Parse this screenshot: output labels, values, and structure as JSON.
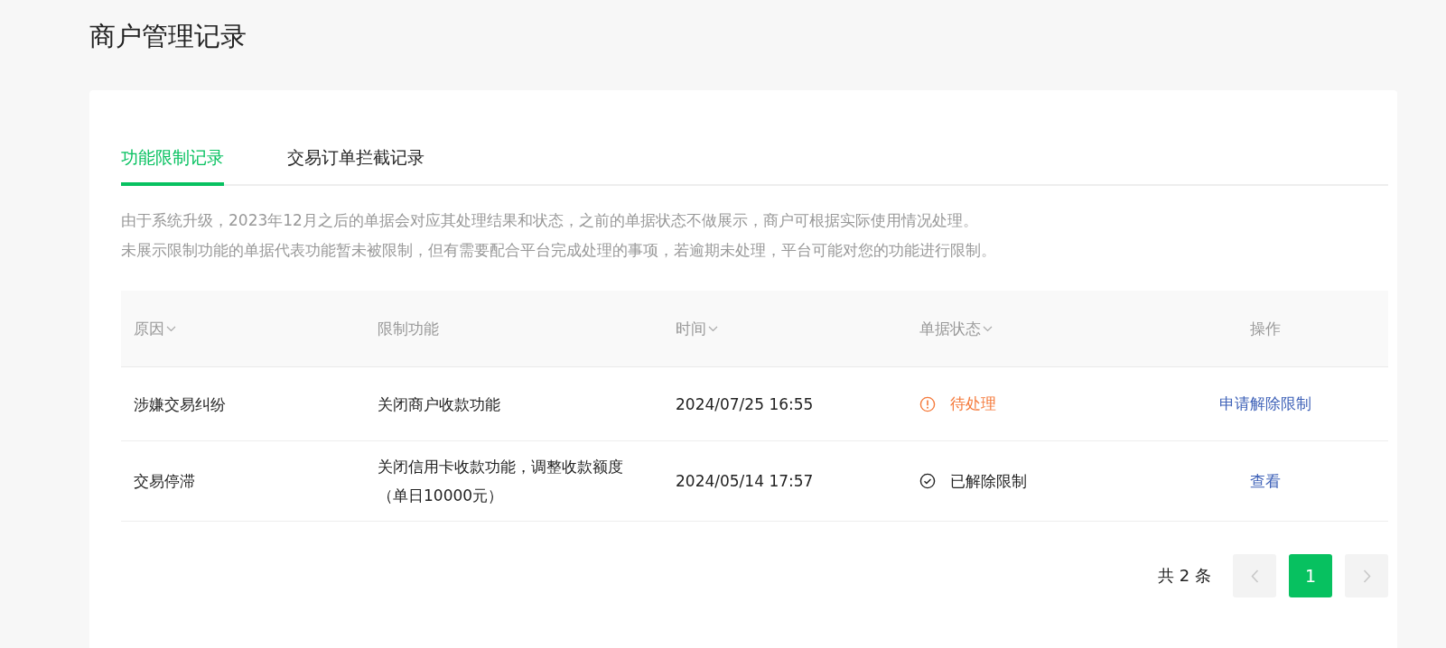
{
  "page_title": "商户管理记录",
  "tabs": [
    {
      "label": "功能限制记录",
      "selected": true
    },
    {
      "label": "交易订单拦截记录",
      "selected": false
    }
  ],
  "notice": [
    "由于系统升级，2023年12月之后的单据会对应其处理结果和状态，之前的单据状态不做展示，商户可根据实际使用情况处理。",
    "未展示限制功能的单据代表功能暂未被限制，但有需要配合平台完成处理的事项，若逾期未处理，平台可能对您的功能进行限制。"
  ],
  "table": {
    "columns": [
      {
        "label": "原因",
        "sortable": true
      },
      {
        "label": "限制功能",
        "sortable": false
      },
      {
        "label": "时间",
        "sortable": true
      },
      {
        "label": "单据状态",
        "sortable": true
      },
      {
        "label": "操作",
        "sortable": false
      }
    ],
    "rows": [
      {
        "reason": "涉嫌交易纠纷",
        "function": "关闭商户收款功能",
        "time": "2024/07/25 16:55",
        "status": {
          "kind": "pending",
          "label": "待处理"
        },
        "action": "申请解除限制"
      },
      {
        "reason": "交易停滞",
        "function": "关闭信用卡收款功能，调整收款额度（单日10000元）",
        "time": "2024/05/14 17:57",
        "status": {
          "kind": "resolved",
          "label": "已解除限制"
        },
        "action": "查看"
      }
    ]
  },
  "pagination": {
    "total": "共 2 条",
    "prev_disabled": true,
    "next_disabled": true,
    "pages": [
      {
        "label": "1",
        "selected": true
      }
    ]
  }
}
